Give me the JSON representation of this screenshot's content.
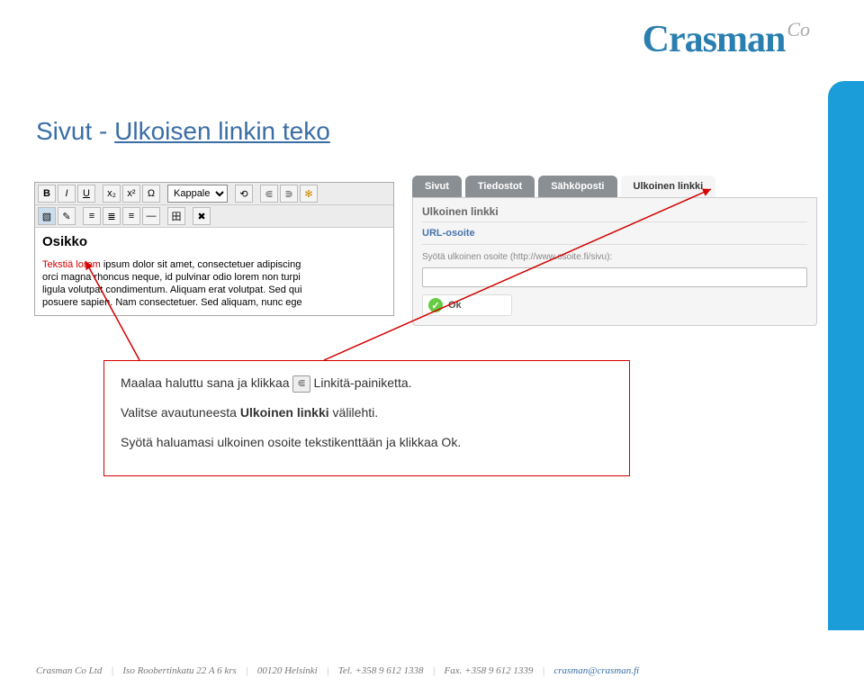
{
  "logo": {
    "main": "Crasman",
    "suffix": "Co"
  },
  "page_title": {
    "prefix": "Sivut - ",
    "link": "Ulkoisen linkin teko"
  },
  "editor": {
    "toolbar": {
      "bold": "B",
      "italic": "I",
      "underline": "U",
      "sub": "x₂",
      "sup": "x²",
      "omega": "Ω",
      "para_select": "Kappale",
      "link": "⋐",
      "unlink": "⋑",
      "magic": "✻",
      "image": "▧",
      "edit": "✎",
      "left": "≡",
      "center": "≣",
      "right": "≡",
      "hr": "—",
      "table": "田",
      "clear1": "⟲",
      "clear2": "✖"
    },
    "heading": "Osikko",
    "body_red": "Tekstiä lorem",
    "body_rest1": " ipsum dolor sit amet, consectetuer adipiscing",
    "body_line2": "orci magna rhoncus neque, id pulvinar odio lorem non turpi",
    "body_line3": "ligula volutpat condimentum. Aliquam erat volutpat. Sed qui",
    "body_line4": "posuere sapien. Nam consectetuer. Sed aliquam, nunc ege"
  },
  "dialog": {
    "tabs": [
      "Sivut",
      "Tiedostot",
      "Sähköposti",
      "Ulkoinen linkki"
    ],
    "pane_title": "Ulkoinen linkki",
    "sub": "URL-osoite",
    "hint": "Syötä ulkoinen osoite (http://www.osoite.fi/sivu):",
    "ok": "Ok"
  },
  "instructions": {
    "p1a": "Maalaa haluttu sana ja klikkaa ",
    "p1b": " Linkitä-painiketta.",
    "p2a": "Valitse avautuneesta ",
    "p2b": "Ulkoinen linkki",
    "p2c": " välilehti.",
    "p3": "Syötä haluamasi ulkoinen osoite tekstikenttään ja klikkaa Ok."
  },
  "footer": {
    "company": "Crasman Co Ltd",
    "addr1": "Iso Roobertinkatu 22 A 6 krs",
    "addr2": "00120 Helsinki",
    "tel": "Tel. +358 9 612 1338",
    "fax": "Fax. +358 9 612 1339",
    "email": "crasman@crasman.fi"
  }
}
